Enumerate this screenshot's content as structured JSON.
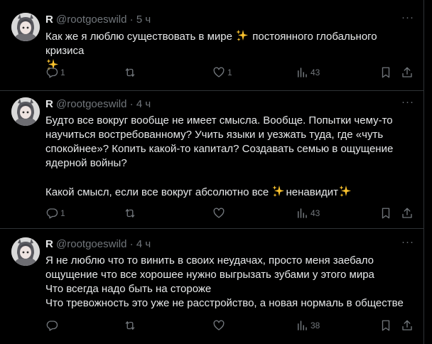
{
  "colors": {
    "background": "#000000",
    "text": "#e7e9ea",
    "muted": "#71767b",
    "border": "#2f3336",
    "sparkle": "#f9c22e"
  },
  "tweets": [
    {
      "name": "R",
      "handle": "@rootgoeswild",
      "dot": "·",
      "time": "5 ч",
      "more": "···",
      "lines": [
        [
          "Как же я люблю существовать в мире ",
          "✨",
          " постоянного глобального кризиса"
        ],
        [
          "✨"
        ]
      ],
      "replies": "1",
      "reposts": "",
      "likes": "1",
      "views": "43"
    },
    {
      "name": "R",
      "handle": "@rootgoeswild",
      "dot": "·",
      "time": "4 ч",
      "more": "···",
      "lines": [
        [
          "Будто все вокруг вообще не имеет смысла. Вообще. Попытки чему-то"
        ],
        [
          "научиться востребованному? Учить языки и уезжать туда, где «чуть"
        ],
        [
          "спокойнее»?  Копить какой-то капитал? Создавать семью в ощущение"
        ],
        [
          "ядерной войны?"
        ],
        [
          ""
        ],
        [
          "Какой смысл, если все вокруг абсолютно все ",
          "✨",
          "ненавидит",
          "✨"
        ]
      ],
      "replies": "1",
      "reposts": "",
      "likes": "",
      "views": "43"
    },
    {
      "name": "R",
      "handle": "@rootgoeswild",
      "dot": "·",
      "time": "4 ч",
      "more": "···",
      "lines": [
        [
          "Я не люблю что то винить в своих неудачах, просто меня заебало"
        ],
        [
          "ощущение что все хорошее нужно выгрызать зубами у этого мира"
        ],
        [
          "Что всегда надо быть на стороже"
        ],
        [
          "Что тревожность это уже не расстройство, а новая нормаль в обществе"
        ]
      ],
      "replies": "",
      "reposts": "",
      "likes": "",
      "views": "38"
    }
  ]
}
